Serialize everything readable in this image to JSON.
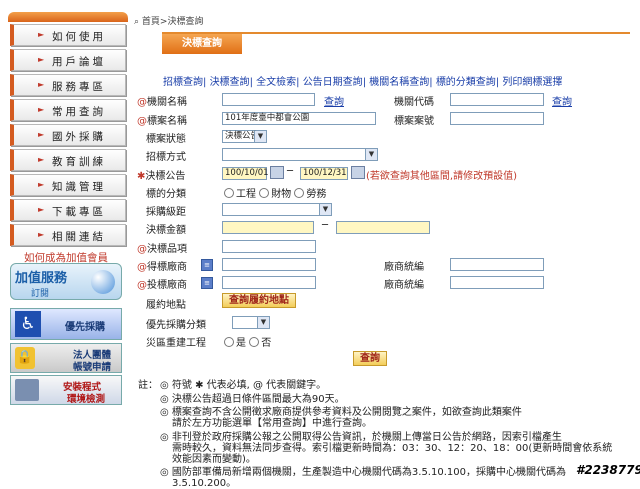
{
  "sidebar": {
    "items": [
      {
        "label": "如何使用"
      },
      {
        "label": "用戶論壇"
      },
      {
        "label": "服務專區"
      },
      {
        "label": "常用查詢"
      },
      {
        "label": "國外採購"
      },
      {
        "label": "教育訓練"
      },
      {
        "label": "知識管理"
      },
      {
        "label": "下載專區"
      },
      {
        "label": "相關連結"
      }
    ],
    "join_text": "如何成為加值會員",
    "ad_add": {
      "title": "加值服務",
      "sub": "訂閱"
    },
    "ad_priority": {
      "title": "優先採購"
    },
    "ad_corp": {
      "line1": "法人團體",
      "line2": "帳號申請"
    },
    "ad_install": {
      "line1": "安裝程式",
      "line2": "環境檢測"
    }
  },
  "breadcrumb": "首頁>決標查詢",
  "tab": {
    "label": "決標查詢"
  },
  "links": [
    "招標查詢",
    "決標查詢",
    "全文檢索",
    "公告日期查詢",
    "機關名稱查詢",
    "標的分類查詢",
    "列印網標選擇"
  ],
  "form": {
    "agency_name": {
      "label": "機關名稱",
      "query": "查詢"
    },
    "agency_code": {
      "label": "機關代碼",
      "query": "查詢"
    },
    "case_name": {
      "label": "標案名稱",
      "value": "101年度臺中都會公園"
    },
    "case_no": {
      "label": "標案案號"
    },
    "case_status": {
      "label": "標案狀態",
      "value": "決標公告"
    },
    "tender_method": {
      "label": "招標方式"
    },
    "award_notice": {
      "label": "決標公告",
      "from": "100/10/01",
      "to": "100/12/31",
      "dash": "─",
      "hint": "(若欲查詢其他區間,請修改預設值)"
    },
    "category": {
      "label": "標的分類",
      "options": [
        "工程",
        "財物",
        "勞務"
      ]
    },
    "procurement_level": {
      "label": "採購級距"
    },
    "award_amount": {
      "label": "決標金額",
      "dash": "─"
    },
    "award_item": {
      "label": "決標品項"
    },
    "winning_vendor": {
      "label": "得標廠商",
      "uniform_label": "廠商統編"
    },
    "bidding_vendor": {
      "label": "投標廠商",
      "uniform_label": "廠商統編"
    },
    "performance_location": {
      "label": "履約地點",
      "button": "查詢履約地點"
    },
    "priority_category": {
      "label": "優先採購分類"
    },
    "disaster_project": {
      "label": "災區重建工程",
      "options": [
        "是",
        "否"
      ]
    },
    "submit": "查詢"
  },
  "notes": {
    "prefix": "註：",
    "line0": "◎ 符號 ✱ 代表必填, @ 代表關鍵字。",
    "line1": "◎ 決標公告超過日條件區間最大為90天。",
    "line2a": "◎ 標案查詢不含公開徵求廠商提供參考資料及公開閱覽之案件，如欲查詢此類案件",
    "line2b": "請於左方功能選單【常用查詢】中進行查詢。",
    "line3a": "◎ 非刊登於政府採購公報之公開取得公告資訊，於機關上傳當日公告於網路，因索引檔產生",
    "line3b": "需時較久，資料無法同步查得。索引檔更新時間為：03：30、12：20、18：00(更新時間會依系統",
    "line3c": "效能因素而變動)。",
    "line4a": "◎ 國防部軍備局新增兩個機關，生產製造中心機關代碼為3.5.10.100，採購中心機關代碼為",
    "line4b": "3.5.10.200。"
  },
  "watermark": "#2238779"
}
